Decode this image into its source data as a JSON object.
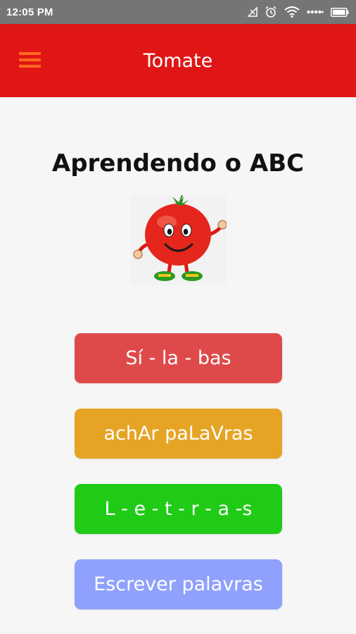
{
  "status_bar": {
    "time": "12:05 PM",
    "icons": [
      "signal-icon",
      "alarm-icon",
      "wifi-icon",
      "cellular-dots-icon",
      "battery-icon"
    ]
  },
  "app_bar": {
    "title": "Tomate",
    "menu_icon": "hamburger-menu-icon",
    "background": "#e01616",
    "menu_color": "#ff6a1f"
  },
  "main": {
    "heading": "Aprendendo o ABC",
    "mascot": "tomato-mascot-image",
    "buttons": [
      {
        "label": "Sí - la - bas",
        "color": "#de4a4a"
      },
      {
        "label": "achAr paLaVras",
        "color": "#e6a425"
      },
      {
        "label": "L - e - t - r - a -s",
        "color": "#1fcb16"
      },
      {
        "label": "Escrever palavras",
        "color": "#8fa1fc"
      }
    ]
  }
}
